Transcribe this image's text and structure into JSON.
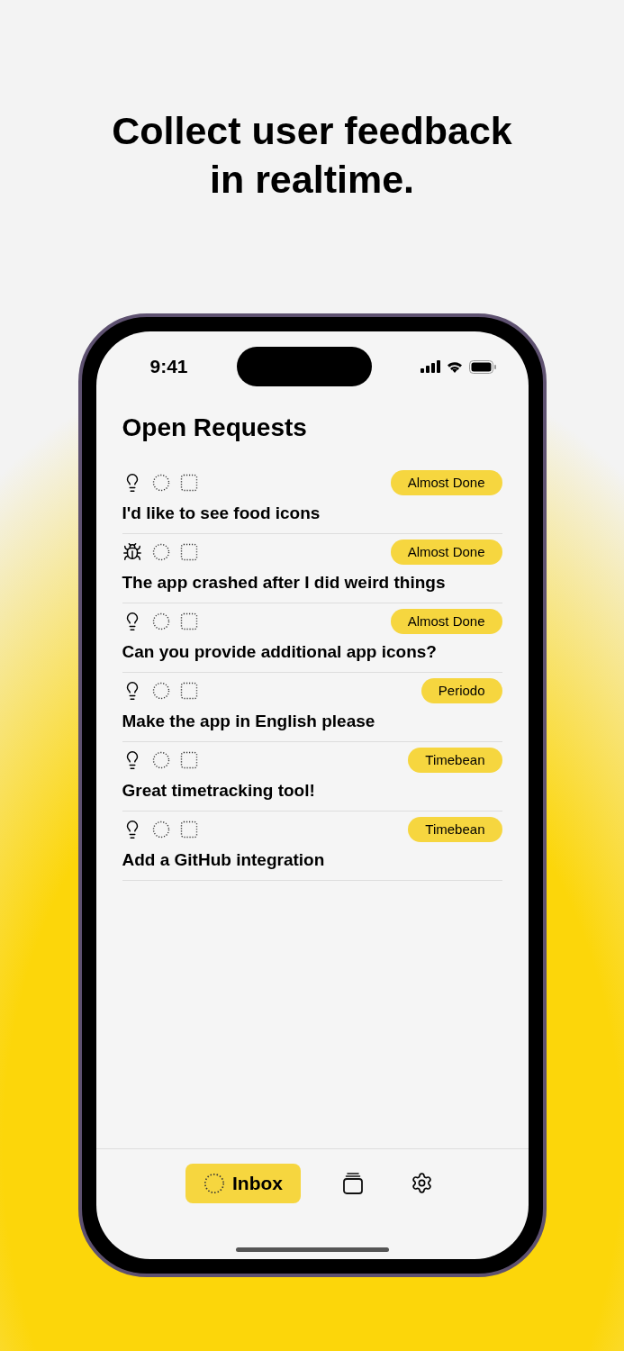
{
  "headline": "Collect user feedback\nin realtime.",
  "status_bar": {
    "time": "9:41"
  },
  "title": "Open Requests",
  "requests": [
    {
      "kind": "idea",
      "tag": "Almost Done",
      "text": "I'd like to see food icons"
    },
    {
      "kind": "bug",
      "tag": "Almost Done",
      "text": "The app crashed after I did weird things"
    },
    {
      "kind": "idea",
      "tag": "Almost Done",
      "text": "Can you provide additional app icons?"
    },
    {
      "kind": "idea",
      "tag": "Periodo",
      "text": "Make the app in English please"
    },
    {
      "kind": "idea",
      "tag": "Timebean",
      "text": "Great timetracking tool!"
    },
    {
      "kind": "idea",
      "tag": "Timebean",
      "text": "Add a GitHub integration"
    }
  ],
  "tab_bar": [
    {
      "kind": "inbox",
      "label": "Inbox",
      "selected": true
    },
    {
      "kind": "stack",
      "selected": false
    },
    {
      "kind": "settings",
      "selected": false
    }
  ]
}
